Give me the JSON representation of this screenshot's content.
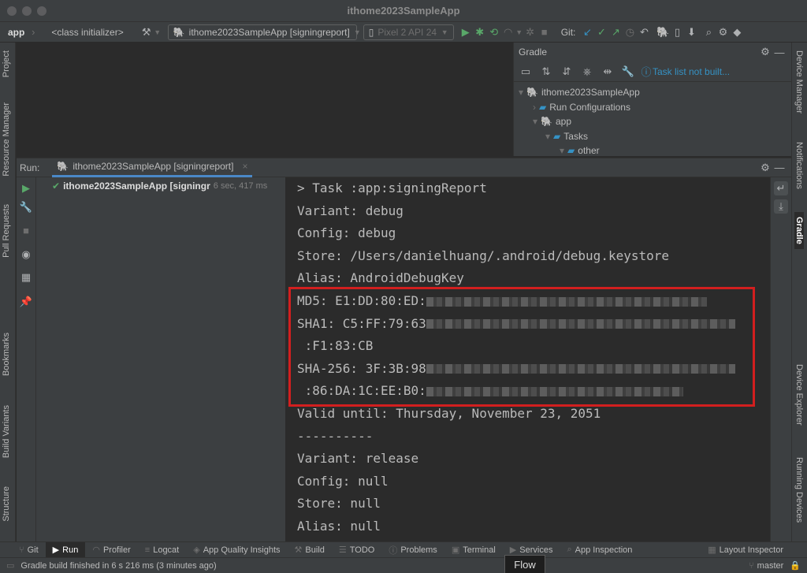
{
  "window": {
    "title": "ithome2023SampleApp"
  },
  "toolbar": {
    "app": "app",
    "breadcrumb": "<class initializer>",
    "run_config": "ithome2023SampleApp [signingreport]",
    "device": "Pixel 2 API 24",
    "git_label": "Git:"
  },
  "left_stripe": [
    "Project",
    "Resource Manager",
    "Pull Requests",
    "Bookmarks",
    "Build Variants",
    "Structure"
  ],
  "right_stripe": [
    "Device Manager",
    "Notifications",
    "Gradle",
    "Device Explorer",
    "Running Devices"
  ],
  "gradle": {
    "header": "Gradle",
    "task_link": "Task list not built...",
    "tree": [
      {
        "label": "ithome2023SampleApp",
        "level": 0,
        "arrow": "▾"
      },
      {
        "label": "Run Configurations",
        "level": 1,
        "arrow": "›"
      },
      {
        "label": "app",
        "level": 1,
        "arrow": "▾"
      },
      {
        "label": "Tasks",
        "level": 2,
        "arrow": "▾"
      },
      {
        "label": "other",
        "level": 3,
        "arrow": "▾"
      }
    ]
  },
  "run": {
    "label": "Run:",
    "tab": "ithome2023SampleApp [signingreport]",
    "tree_item": "ithome2023SampleApp [signingr",
    "tree_time": "6 sec, 417 ms"
  },
  "console": {
    "lines": [
      "> Task :app:signingReport",
      "Variant: debug",
      "Config: debug",
      "Store: /Users/danielhuang/.android/debug.keystore",
      "Alias: AndroidDebugKey",
      "MD5: E1:DD:80:ED:",
      "SHA1: C5:FF:79:63",
      " :F1:83:CB",
      "SHA-256: 3F:3B:98",
      " :86:DA:1C:EE:B0:",
      "Valid until: Thursday, November 23, 2051",
      "----------",
      "Variant: release",
      "Config: null",
      "Store: null",
      "Alias: null"
    ]
  },
  "bottom_tools": [
    {
      "label": "Git",
      "icon": "git-icon"
    },
    {
      "label": "Run",
      "icon": "run-icon",
      "selected": true
    },
    {
      "label": "Profiler",
      "icon": "profiler-icon"
    },
    {
      "label": "Logcat",
      "icon": "logcat-icon"
    },
    {
      "label": "App Quality Insights",
      "icon": "insights-icon"
    },
    {
      "label": "Build",
      "icon": "build-icon"
    },
    {
      "label": "TODO",
      "icon": "todo-icon"
    },
    {
      "label": "Problems",
      "icon": "problems-icon"
    },
    {
      "label": "Terminal",
      "icon": "terminal-icon"
    },
    {
      "label": "Services",
      "icon": "services-icon"
    },
    {
      "label": "App Inspection",
      "icon": "inspection-icon"
    }
  ],
  "layout_inspector": "Layout Inspector",
  "status": {
    "message": "Gradle build finished in 6 s 216 ms (3 minutes ago)",
    "branch": "master",
    "flow": "Flow"
  },
  "colors": {
    "highlight": "#d21f1f",
    "accent": "#3592c4",
    "success": "#59a869"
  }
}
